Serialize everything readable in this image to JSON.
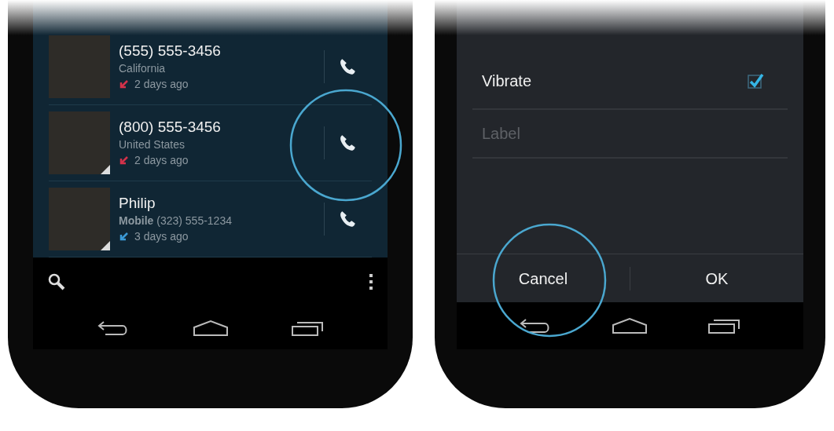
{
  "call_log": {
    "entries": [
      {
        "title": "(555) 555-3456",
        "detail": "California",
        "time": "2 days ago",
        "kind": "missed",
        "badge": false
      },
      {
        "title": "(800) 555-3456",
        "detail": "United States",
        "time": "2 days ago",
        "kind": "missed",
        "badge": true
      },
      {
        "title": "Philip",
        "detail": "**Mobile** (323) 555-1234",
        "time": "3 days ago",
        "kind": "incoming",
        "badge": true
      }
    ]
  },
  "alarm_dialog": {
    "options": [
      {
        "kind": "checkbox",
        "label": "Vibrate",
        "checked": true
      },
      {
        "kind": "field",
        "placeholder": "Label"
      }
    ],
    "buttons": [
      "Cancel",
      "OK"
    ]
  }
}
